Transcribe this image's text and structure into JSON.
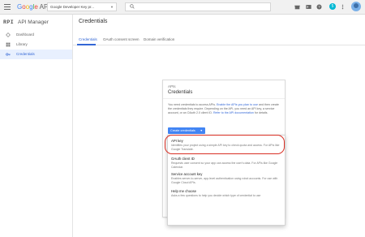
{
  "topbar": {
    "brand": {
      "google": "Google",
      "apis": "APIs"
    },
    "project": "Google Developer Key pr...",
    "badge": "5"
  },
  "nav": {
    "logo": "RPI",
    "title": "API Manager",
    "items": [
      {
        "label": "Dashboard",
        "icon": "dashboard-icon"
      },
      {
        "label": "Library",
        "icon": "library-icon"
      },
      {
        "label": "Credentials",
        "icon": "key-icon",
        "active": true
      }
    ]
  },
  "page": {
    "title": "Credentials",
    "tabs": [
      {
        "label": "Credentials",
        "active": true
      },
      {
        "label": "OAuth consent screen"
      },
      {
        "label": "Domain verification"
      }
    ]
  },
  "card": {
    "subtitle": "APIs",
    "title": "Credentials",
    "desc_part1": "You need credentials to access APIs. ",
    "desc_link1": "Enable the APIs you plan to use",
    "desc_part2": " and then create the credentials they require. Depending on the API, you need an API key, a service account, or an OAuth 2.0 client ID. ",
    "desc_link2": "Refer to the API documentation",
    "desc_part3": " for details.",
    "create_button": "Create credentials"
  },
  "dropdown": {
    "items": [
      {
        "name": "API key",
        "desc": "Identifies your project using a simple API key to check quota and access. For APIs like Google Translate."
      },
      {
        "name": "OAuth client ID",
        "desc": "Requests user consent so your app can access the user's data. For APIs like Google Calendar."
      },
      {
        "name": "Service account key",
        "desc": "Enables server-to-server, app-level authentication using robot accounts. For use with Google Cloud APIs."
      },
      {
        "name": "Help me choose",
        "desc": "Asks a few questions to help you decide which type of credential to use"
      }
    ]
  },
  "colors": {
    "accent": "#4285f4",
    "highlight": "#d93025",
    "active_nav": "#e8f0fe"
  }
}
